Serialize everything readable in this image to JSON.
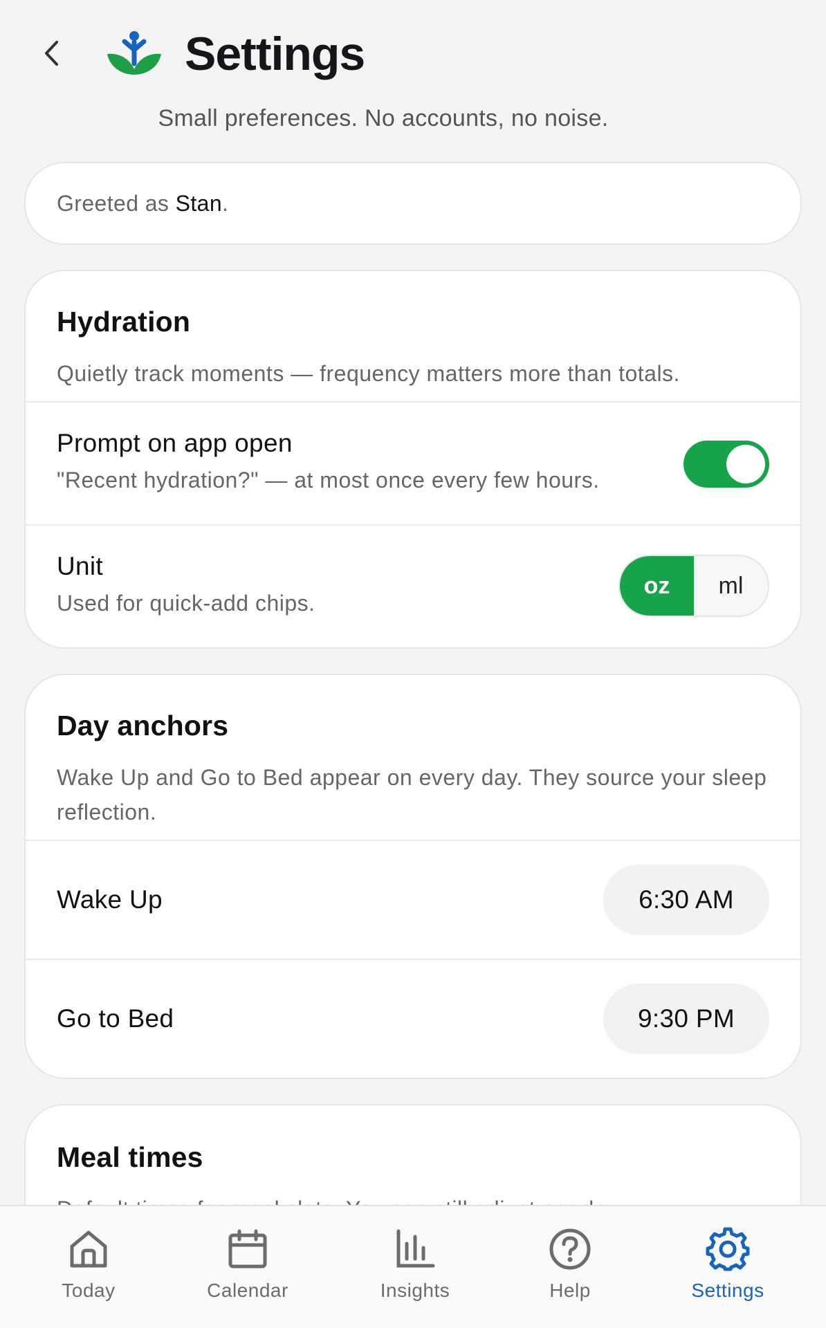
{
  "header": {
    "title": "Settings",
    "subtitle": "Small preferences. No accounts, no noise."
  },
  "greeting": {
    "prefix": "Greeted as",
    "name": "Stan",
    "suffix": "."
  },
  "hydration": {
    "title": "Hydration",
    "description": "Quietly track moments — frequency matters more than totals.",
    "prompt": {
      "title": "Prompt on app open",
      "subtitle": "\"Recent hydration?\" — at most once every few hours.",
      "enabled": true
    },
    "unit": {
      "title": "Unit",
      "subtitle": "Used for quick-add chips.",
      "options": [
        "oz",
        "ml"
      ],
      "selected": "oz"
    }
  },
  "day_anchors": {
    "title": "Day anchors",
    "description": "Wake Up and Go to Bed appear on every day. They source your sleep reflection.",
    "wake": {
      "label": "Wake Up",
      "time": "6:30 AM"
    },
    "bed": {
      "label": "Go to Bed",
      "time": "9:30 PM"
    }
  },
  "meal_times": {
    "title": "Meal times",
    "description": "Default times for meal slots. You can still adjust per day."
  },
  "tabs": [
    {
      "label": "Today",
      "icon": "home-icon"
    },
    {
      "label": "Calendar",
      "icon": "calendar-icon"
    },
    {
      "label": "Insights",
      "icon": "bar-chart-icon"
    },
    {
      "label": "Help",
      "icon": "help-icon"
    },
    {
      "label": "Settings",
      "icon": "gear-icon"
    }
  ],
  "active_tab": "Settings",
  "colors": {
    "accent_green": "#16a34a",
    "active_tab_blue": "#1565c0",
    "background": "#f4f4f5"
  }
}
